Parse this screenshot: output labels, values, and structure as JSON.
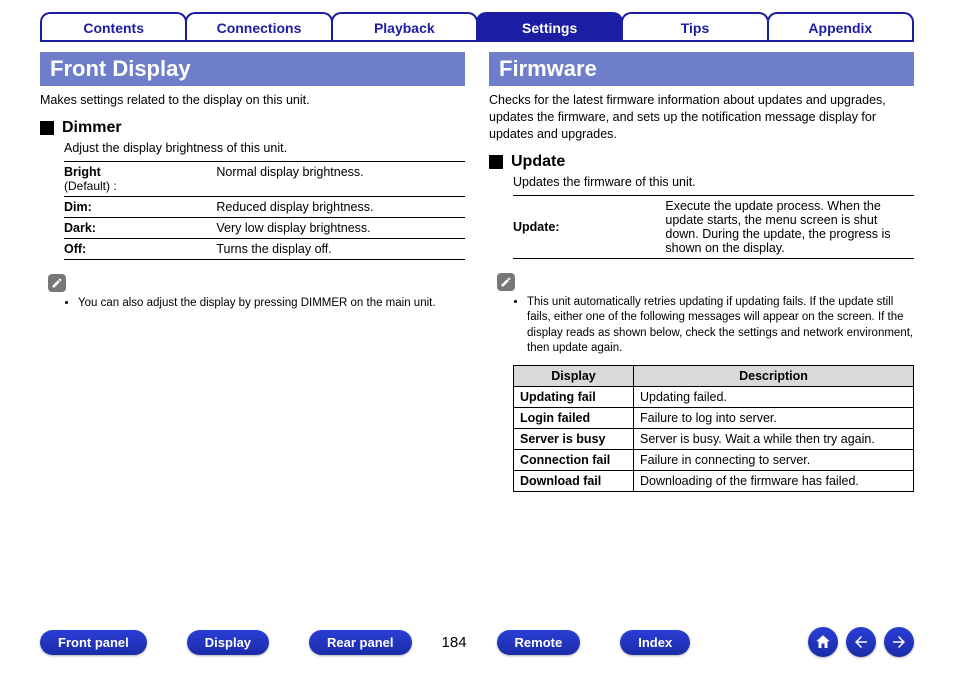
{
  "tabs": {
    "items": [
      {
        "label": "Contents",
        "active": false
      },
      {
        "label": "Connections",
        "active": false
      },
      {
        "label": "Playback",
        "active": false
      },
      {
        "label": "Settings",
        "active": true
      },
      {
        "label": "Tips",
        "active": false
      },
      {
        "label": "Appendix",
        "active": false
      }
    ]
  },
  "left": {
    "title": "Front Display",
    "intro": "Makes settings related to the display on this unit.",
    "sub_title": "Dimmer",
    "sub_desc": "Adjust the display brightness of this unit.",
    "options": [
      {
        "key_html": "Bright",
        "key_sub": "(Default) :",
        "val": "Normal display brightness."
      },
      {
        "key_html": "Dim:",
        "key_sub": "",
        "val": "Reduced display brightness."
      },
      {
        "key_html": "Dark:",
        "key_sub": "",
        "val": "Very low display brightness."
      },
      {
        "key_html": "Off:",
        "key_sub": "",
        "val": "Turns the display off."
      }
    ],
    "note": "You can also adjust the display by pressing DIMMER on the main unit."
  },
  "right": {
    "title": "Firmware",
    "intro": "Checks for the latest firmware information about updates and upgrades, updates the firmware, and sets up the notification message display for updates and upgrades.",
    "sub_title": "Update",
    "sub_desc": "Updates the firmware of this unit.",
    "options": [
      {
        "key_html": "Update:",
        "val": "Execute the update process. When the update starts, the menu screen is shut down. During the update, the progress is shown on the display."
      }
    ],
    "note": "This unit automatically retries updating if updating fails. If the update still fails, either one of the following messages will appear on the screen. If the display reads as shown below, check the settings and network environment, then update again.",
    "table_head": {
      "c1": "Display",
      "c2": "Description"
    },
    "table_rows": [
      {
        "k": "Updating fail",
        "v": "Updating failed."
      },
      {
        "k": "Login failed",
        "v": "Failure to log into server."
      },
      {
        "k": "Server is busy",
        "v": "Server is busy. Wait a while then try again."
      },
      {
        "k": "Connection fail",
        "v": "Failure in connecting to server."
      },
      {
        "k": "Download fail",
        "v": "Downloading of the firmware has failed."
      }
    ]
  },
  "footer": {
    "buttons": [
      "Front panel",
      "Display",
      "Rear panel"
    ],
    "page": "184",
    "buttons2": [
      "Remote",
      "Index"
    ]
  }
}
